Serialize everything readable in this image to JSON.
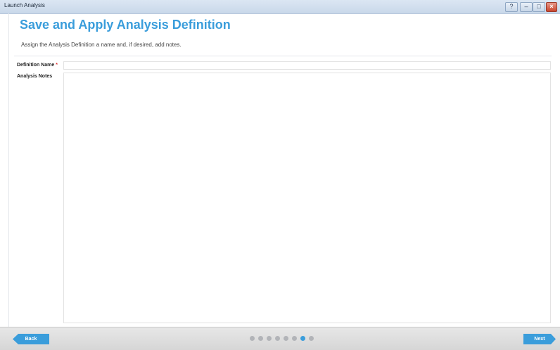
{
  "window": {
    "title": "Launch Analysis",
    "controls": [
      {
        "name": "help-button",
        "icon": "help-icon",
        "glyph": "?"
      },
      {
        "name": "minimize-button",
        "icon": "minimize-icon",
        "glyph": "–"
      },
      {
        "name": "maximize-button",
        "icon": "maximize-icon",
        "glyph": "□"
      },
      {
        "name": "close-button",
        "icon": "close-icon",
        "glyph": "×"
      }
    ]
  },
  "header": {
    "title": "Save and Apply Analysis Definition",
    "subtitle": "Assign the Analysis Definition a name and, if desired, add notes."
  },
  "form": {
    "definition_name_label": "Definition Name",
    "required_marker": "*",
    "definition_name_value": "",
    "analysis_notes_label": "Analysis Notes",
    "analysis_notes_value": ""
  },
  "footer": {
    "back_label": "Back",
    "next_label": "Next",
    "steps_total": 8,
    "current_step": 7
  },
  "colors": {
    "accent": "#3a9ddb",
    "dot_inactive": "#b2b4b8",
    "required": "#d33333"
  }
}
